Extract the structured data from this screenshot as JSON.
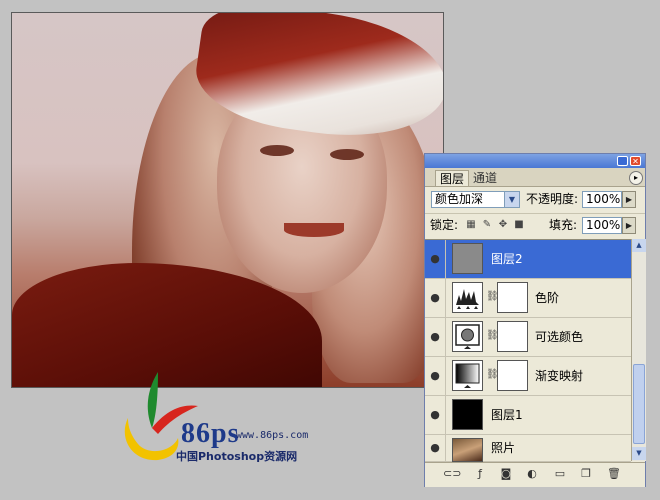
{
  "branding": {
    "logo_text": "86ps",
    "url": "www.86ps.com",
    "site_name": "中国Photoshop资源网"
  },
  "panel": {
    "tabs": [
      {
        "label": "图层",
        "active": true
      },
      {
        "label": "通道",
        "active": false
      }
    ],
    "blend_mode": "颜色加深",
    "opacity_label": "不透明度:",
    "opacity_value": "100%",
    "lock_label": "锁定:",
    "fill_label": "填充:",
    "fill_value": "100%",
    "layers": [
      {
        "name": "图层2",
        "selected": true,
        "thumb": "gray-fill",
        "has_mask": false
      },
      {
        "name": "色阶",
        "selected": false,
        "thumb": "levels-histogram",
        "has_mask": true
      },
      {
        "name": "可选颜色",
        "selected": false,
        "thumb": "selective-color",
        "has_mask": true
      },
      {
        "name": "渐变映射",
        "selected": false,
        "thumb": "gradient-map",
        "has_mask": true
      },
      {
        "name": "图层1",
        "selected": false,
        "thumb": "black-fill",
        "has_mask": false
      },
      {
        "name": "照片",
        "selected": false,
        "thumb": "photo",
        "has_mask": false
      }
    ]
  },
  "colors": {
    "selection": "#3a6ad4",
    "panel_bg": "#ece9d8",
    "workspace": "#c2c2c2"
  }
}
